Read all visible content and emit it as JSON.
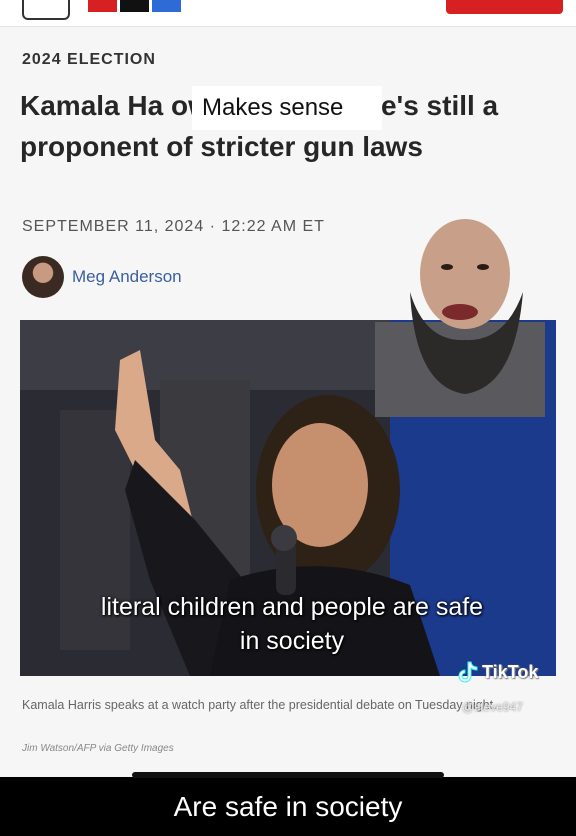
{
  "article": {
    "kicker": "2024 ELECTION",
    "headline": "Kamala Ha owner — but she's still a proponent of stricter gun laws",
    "dateline": "SEPTEMBER 11, 2024 · 12:22 AM ET",
    "author": "Meg Anderson",
    "caption": "Kamala Harris speaks at a watch party after the presidential debate on Tuesday night.",
    "credit": "Jim Watson/AFP via Getty Images"
  },
  "overlay": {
    "top_label": "Makes sense",
    "subtitle_photo": "literal children and people are safe in society",
    "subtitle_bottom": "Are safe in society"
  },
  "watermark": {
    "brand": "TikTok",
    "handle": "@steve947"
  },
  "colors": {
    "donate": "#d62021",
    "author_link": "#3a5fa0",
    "logo": [
      "#d62021",
      "#111111",
      "#2e6bd6"
    ]
  },
  "icons": {
    "menu": "menu-icon",
    "logo": "npr-logo",
    "tiktok": "tiktok-icon"
  }
}
